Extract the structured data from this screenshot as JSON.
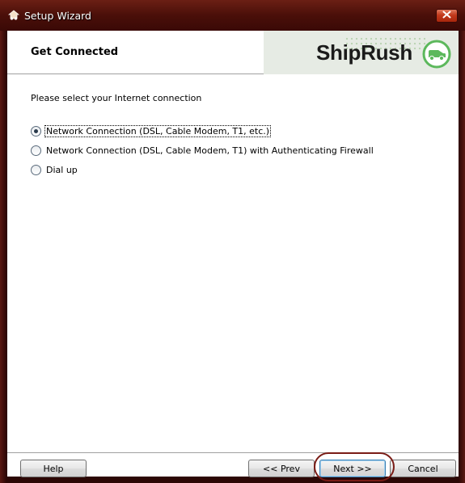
{
  "window": {
    "title": "Setup Wizard"
  },
  "header": {
    "title": "Get Connected",
    "logo_text": "ShipRush"
  },
  "body": {
    "prompt": "Please select your Internet connection",
    "options": [
      {
        "label": "Network Connection (DSL, Cable Modem, T1, etc.)",
        "selected": true
      },
      {
        "label": "Network Connection (DSL, Cable Modem, T1) with Authenticating Firewall",
        "selected": false
      },
      {
        "label": "Dial up",
        "selected": false
      }
    ]
  },
  "footer": {
    "help_label": "Help",
    "prev_label": "<< Prev",
    "next_label": "Next >>",
    "cancel_label": "Cancel"
  },
  "colors": {
    "title_bar": "#4a0f09",
    "close_button": "#c2391c",
    "logo_green": "#5cb85c"
  }
}
